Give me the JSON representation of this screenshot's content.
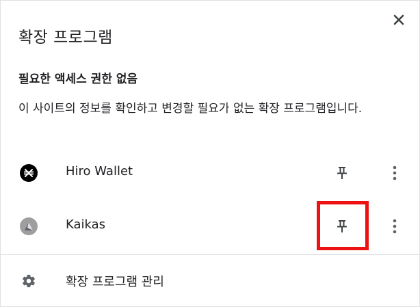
{
  "popup": {
    "title": "확장 프로그램"
  },
  "section": {
    "heading": "필요한 액세스 권한 없음",
    "description": "이 사이트의 정보를 확인하고 변경할 필요가 없는 확장 프로그램입니다."
  },
  "extensions": [
    {
      "name": "Hiro Wallet",
      "icon": "hiro-wallet-icon",
      "pin_icon": "pin-icon",
      "menu_icon": "more-vert-icon"
    },
    {
      "name": "Kaikas",
      "icon": "kaikas-icon",
      "pin_icon": "pin-icon",
      "menu_icon": "more-vert-icon"
    }
  ],
  "footer": {
    "manage_label": "확장 프로그램 관리",
    "icon": "gear-icon"
  },
  "colors": {
    "highlight": "#ee1111",
    "text": "#202124",
    "icon": "#5f6368",
    "divider": "#dadce0"
  }
}
